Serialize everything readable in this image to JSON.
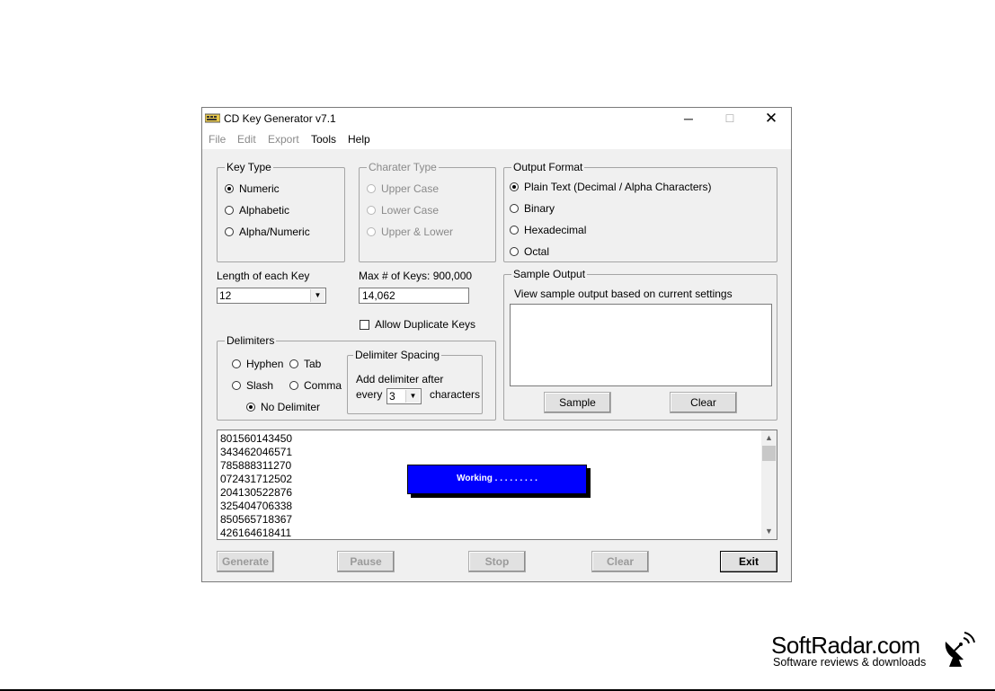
{
  "window": {
    "title": "CD Key Generator v7.1",
    "controls": {
      "minimize": "─",
      "maximize": "☐",
      "close": "✕"
    }
  },
  "menu": {
    "file": "File",
    "edit": "Edit",
    "export": "Export",
    "tools": "Tools",
    "help": "Help"
  },
  "key_type": {
    "legend": "Key Type",
    "options": [
      "Numeric",
      "Alphabetic",
      "Alpha/Numeric"
    ],
    "selected": "Numeric"
  },
  "character_type": {
    "legend": "Charater Type",
    "options": [
      "Upper Case",
      "Lower Case",
      "Upper & Lower"
    ]
  },
  "output_format": {
    "legend": "Output Format",
    "options": [
      "Plain Text (Decimal / Alpha Characters)",
      "Binary",
      "Hexadecimal",
      "Octal"
    ],
    "selected": "Plain Text (Decimal / Alpha Characters)"
  },
  "length": {
    "label": "Length of each Key",
    "value": "12"
  },
  "max_keys": {
    "label": "Max # of Keys: 900,000",
    "value": "14,062"
  },
  "allow_duplicates": {
    "label": "Allow Duplicate Keys",
    "checked": false
  },
  "delimiters": {
    "legend": "Delimiters",
    "hyphen": "Hyphen",
    "tab": "Tab",
    "slash": "Slash",
    "comma": "Comma",
    "none": "No Delimiter",
    "selected": "No Delimiter"
  },
  "delimiter_spacing": {
    "legend": "Delimiter Spacing",
    "line1": "Add delimiter after",
    "every": "every",
    "value": "3",
    "characters": "characters"
  },
  "sample_output": {
    "legend": "Sample Output",
    "description": "View sample output based on current settings",
    "sample_button": "Sample",
    "clear_button": "Clear"
  },
  "output_lines": [
    "801560143450",
    "343462046571",
    "785888311270",
    "072431712502",
    "204130522876",
    "325404706338",
    "850565718367",
    "426164618411"
  ],
  "working_dialog": "Working . . . . . . . . .",
  "buttons": {
    "generate": "Generate",
    "pause": "Pause",
    "stop": "Stop",
    "clear": "Clear",
    "exit": "Exit"
  },
  "watermark": {
    "title": "SoftRadar.com",
    "subtitle": "Software reviews & downloads"
  }
}
